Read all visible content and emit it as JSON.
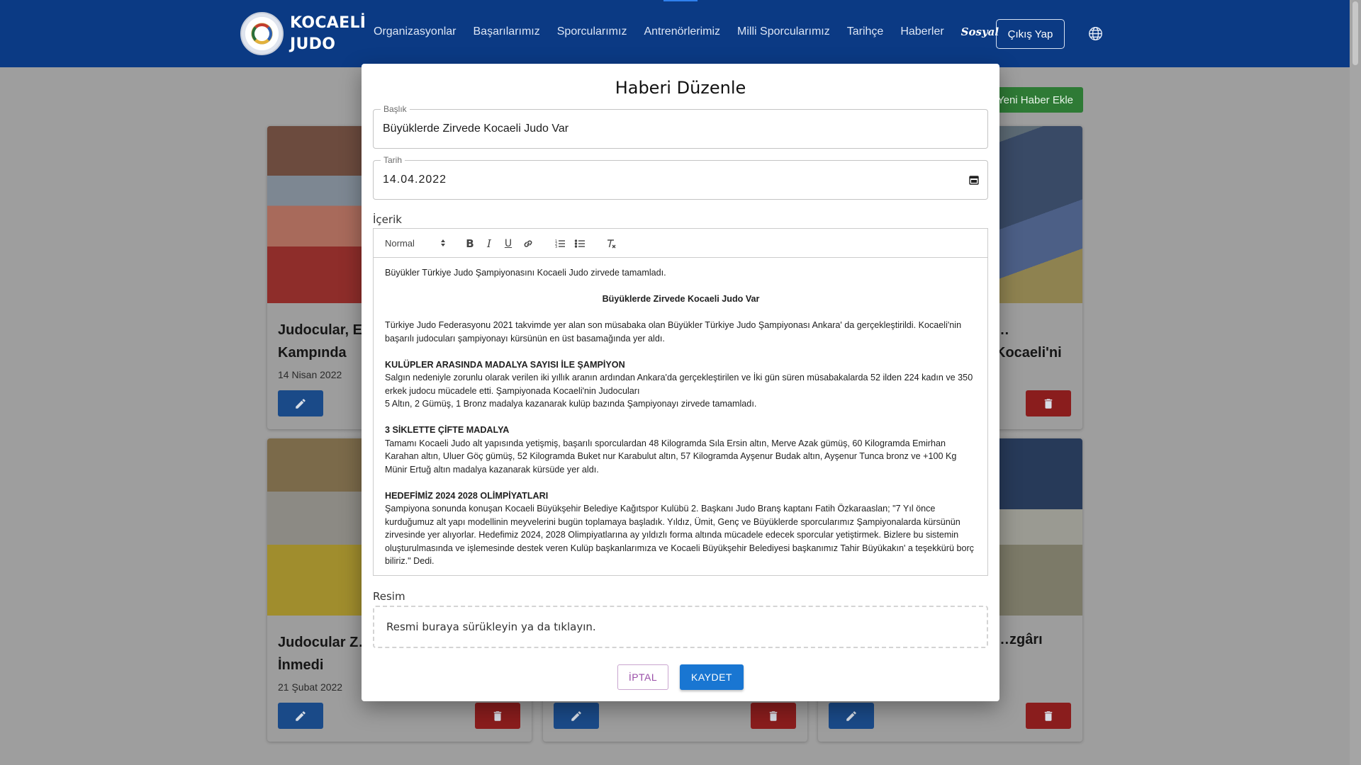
{
  "navbar": {
    "brand_line1": "KOCAELİ",
    "brand_line2": "JUDO",
    "links": [
      "Organizasyonlar",
      "Başarılarımız",
      "Sporcularımız",
      "Antrenörlerimiz",
      "Milli Sporcularımız",
      "Tarihçe",
      "Haberler",
      "Sosyal"
    ],
    "logout_label": "Çıkış Yap",
    "language_icon": "globe-icon"
  },
  "page": {
    "add_news_label": "Yeni Haber Ekle"
  },
  "cards": [
    {
      "title": "Judocular, E…\nKampında",
      "date": "14 Nisan 2022"
    },
    {
      "title": "…Kocaeli'ni",
      "date": ""
    },
    {
      "title": "Judocular Z…\nİnmedi",
      "date": "21 Şubat 2022"
    },
    {
      "title": "",
      "date": ""
    },
    {
      "title": "…zgârı",
      "date": ""
    }
  ],
  "modal": {
    "title": "Haberi Düzenle",
    "title_field": {
      "label": "Başlık",
      "value": "Büyüklerde Zirvede Kocaeli Judo Var"
    },
    "date_field": {
      "label": "Tarih",
      "value": "14.04.2022"
    },
    "content_label": "İçerik",
    "editor": {
      "format_select": "Normal",
      "toolbar": [
        "bold",
        "italic",
        "underline",
        "link",
        "ordered-list",
        "bullet-list",
        "clear-format"
      ],
      "content": {
        "intro": "Büyükler Türkiye Judo Şampiyonasını Kocaeli Judo zirvede tamamladı.",
        "centered_title": "Büyüklerde Zirvede Kocaeli Judo Var",
        "p1": "Türkiye Judo Federasyonu 2021 takvimde yer alan son müsabaka olan Büyükler Türkiye Judo Şampiyonası Ankara' da gerçekleştirildi. Kocaeli'nin başarılı judocuları şampiyonayı kürsünün en üst basamağında yer aldı.",
        "h1": "KULÜPLER ARASINDA MADALYA SAYISI İLE ŞAMPİYON",
        "p2a": "Salgın nedeniyle zorunlu olarak verilen iki yıllık aranın ardından Ankara'da gerçekleştirilen ve İki gün süren müsabakalarda 52 ilden 224 kadın ve 350 erkek judocu mücadele etti. Şampiyonada Kocaeli'nin Judocuları",
        "p2b": "5 Altın, 2 Gümüş, 1 Bronz madalya kazanarak kulüp bazında Şampiyonayı zirvede tamamladı.",
        "h2": "3 SİKLETTE ÇİFTE MADALYA",
        "p3": "Tamamı Kocaeli Judo alt yapısında yetişmiş, başarılı sporculardan 48 Kilogramda Sıla Ersin altın, Merve Azak gümüş, 60 Kilogramda Emirhan Karahan altın, Uluer Göç gümüş, 52 Kilogramda Buket nur Karabulut altın, 57 Kilogramda Ayşenur Budak altın, Ayşenur Tunca bronz ve +100 Kg Münir Ertuğ altın madalya kazanarak kürsüde yer aldı.",
        "h3": "HEDEFİMİZ 2024 2028 OLİMPİYATLARI",
        "p4": "Şampiyona sonunda konuşan Kocaeli Büyükşehir Belediye Kağıtspor Kulübü 2. Başkanı Judo Branş kaptanı Fatih Özkaraaslan; \"7 Yıl önce kurduğumuz alt yapı modellinin meyvelerini bugün toplamaya başladık. Yıldız, Ümit, Genç ve Büyüklerde sporcularımız Şampiyonalarda kürsünün zirvesinde yer alıyorlar. Hedefimiz 2024, 2028 Olimpiyatlarına ay yıldızlı forma altında mücadele edecek sporcular yetiştirmek. Bizlere bu sistemin oluşturulmasında ve işlemesinde destek veren Kulüp başkanlarımıza ve Kocaeli Büyükşehir Belediyesi başkanımız Tahir Büyükakın' a teşekkürü borç biliriz.\" Dedi."
      }
    },
    "image_label": "Resim",
    "dropzone_text": "Resmi buraya sürükleyin ya da tıklayın.",
    "cancel_label": "İPTAL",
    "save_label": "KAYDET"
  },
  "colors": {
    "navbar": "#0b3a84",
    "primary": "#1976d2",
    "cancel_text": "#9a4fa8",
    "danger": "#c62828",
    "success": "#388e3c"
  }
}
